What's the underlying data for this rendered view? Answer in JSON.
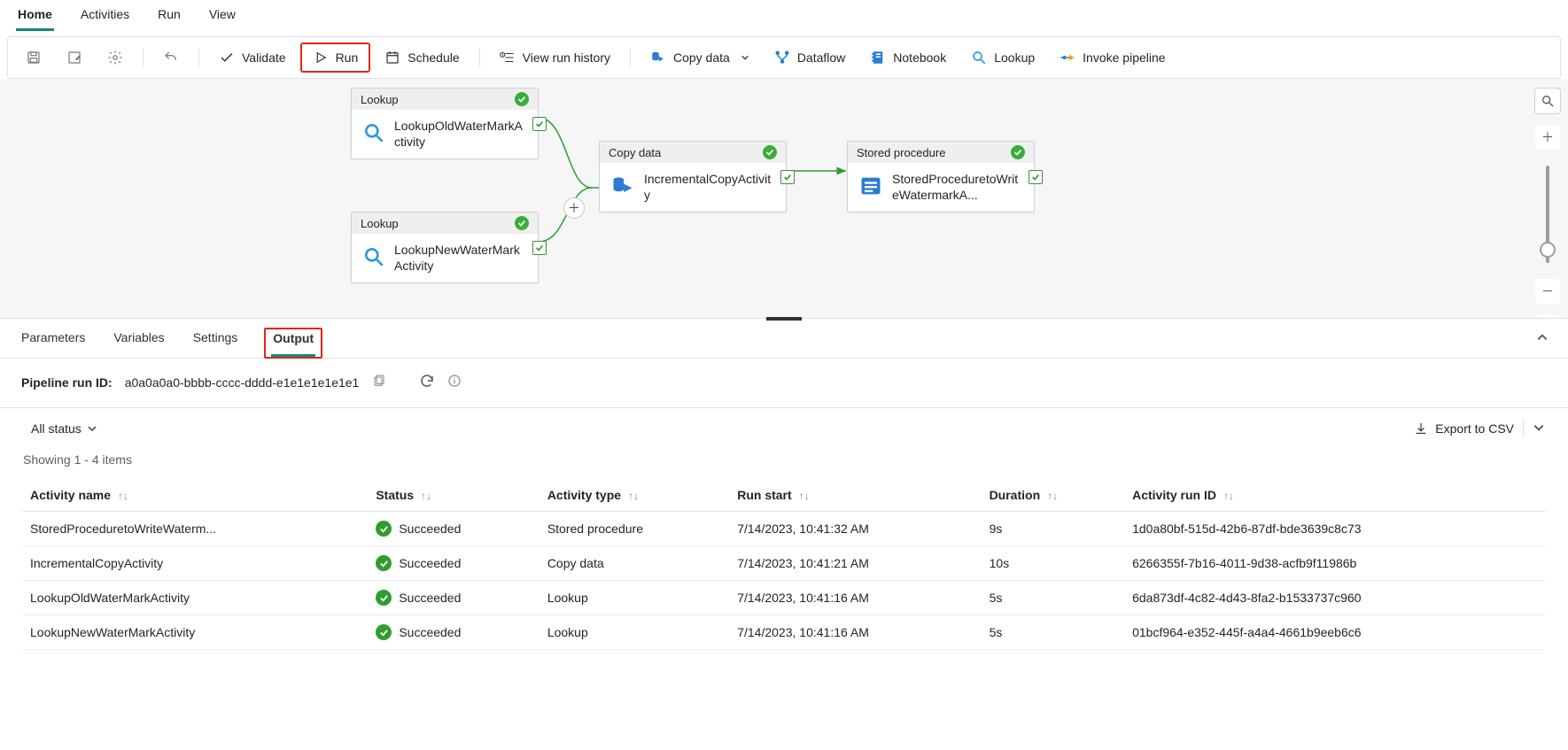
{
  "menu": {
    "items": [
      "Home",
      "Activities",
      "Run",
      "View"
    ],
    "activeIndex": 0
  },
  "toolbar": {
    "validate": "Validate",
    "run": "Run",
    "schedule": "Schedule",
    "viewHistory": "View run history",
    "copyData": "Copy data",
    "dataflow": "Dataflow",
    "notebook": "Notebook",
    "lookup": "Lookup",
    "invokePipeline": "Invoke pipeline"
  },
  "canvas": {
    "nodes": {
      "lookupOld": {
        "type": "Lookup",
        "name": "LookupOldWaterMarkActivity"
      },
      "lookupNew": {
        "type": "Lookup",
        "name": "LookupNewWaterMarkActivity"
      },
      "copy": {
        "type": "Copy data",
        "name": "IncrementalCopyActivity"
      },
      "sp": {
        "type": "Stored procedure",
        "name": "StoredProceduretoWriteWatermarkA..."
      }
    }
  },
  "panel": {
    "tabs": [
      "Parameters",
      "Variables",
      "Settings",
      "Output"
    ],
    "activeIndex": 3,
    "runIdLabel": "Pipeline run ID:",
    "runId": "a0a0a0a0-bbbb-cccc-dddd-e1e1e1e1e1e1",
    "statusFilter": "All status",
    "exportCsv": "Export to CSV",
    "countText": "Showing 1 - 4 items",
    "columns": [
      "Activity name",
      "Status",
      "Activity type",
      "Run start",
      "Duration",
      "Activity run ID"
    ],
    "rows": [
      {
        "name": "StoredProceduretoWriteWaterm...",
        "status": "Succeeded",
        "type": "Stored procedure",
        "start": "7/14/2023, 10:41:32 AM",
        "duration": "9s",
        "runId": "1d0a80bf-515d-42b6-87df-bde3639c8c73"
      },
      {
        "name": "IncrementalCopyActivity",
        "status": "Succeeded",
        "type": "Copy data",
        "start": "7/14/2023, 10:41:21 AM",
        "duration": "10s",
        "runId": "6266355f-7b16-4011-9d38-acfb9f11986b"
      },
      {
        "name": "LookupOldWaterMarkActivity",
        "status": "Succeeded",
        "type": "Lookup",
        "start": "7/14/2023, 10:41:16 AM",
        "duration": "5s",
        "runId": "6da873df-4c82-4d43-8fa2-b1533737c960"
      },
      {
        "name": "LookupNewWaterMarkActivity",
        "status": "Succeeded",
        "type": "Lookup",
        "start": "7/14/2023, 10:41:16 AM",
        "duration": "5s",
        "runId": "01bcf964-e352-445f-a4a4-4661b9eeb6c6"
      }
    ]
  }
}
